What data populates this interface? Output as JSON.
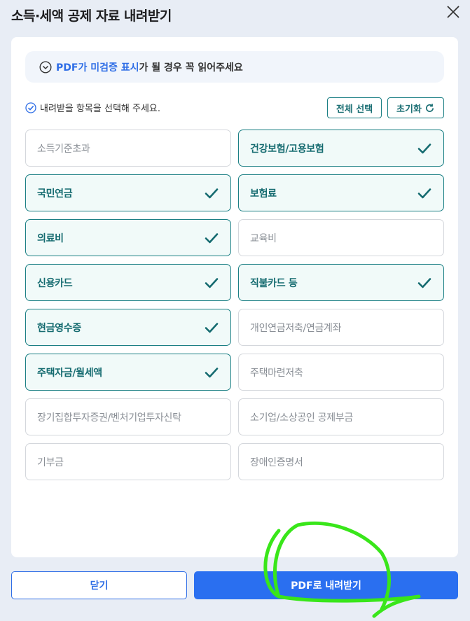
{
  "dialog": {
    "title": "소득·세액 공제 자료 내려받기"
  },
  "notice": {
    "highlight": "PDF가 미검증 표시",
    "rest": "가 될 경우 꼭 읽어주세요"
  },
  "instruction": "내려받을 항목을 선택해 주세요.",
  "buttons": {
    "select_all": "전체 선택",
    "reset": "초기화",
    "close": "닫기",
    "download_pdf": "PDF로 내려받기"
  },
  "items": [
    {
      "label": "소득기준초과",
      "selected": false
    },
    {
      "label": "건강보험/고용보험",
      "selected": true
    },
    {
      "label": "국민연금",
      "selected": true
    },
    {
      "label": "보험료",
      "selected": true
    },
    {
      "label": "의료비",
      "selected": true
    },
    {
      "label": "교육비",
      "selected": false
    },
    {
      "label": "신용카드",
      "selected": true
    },
    {
      "label": "직불카드 등",
      "selected": true
    },
    {
      "label": "현금영수증",
      "selected": true
    },
    {
      "label": "개인연금저축/연금계좌",
      "selected": false
    },
    {
      "label": "주택자금/월세액",
      "selected": true
    },
    {
      "label": "주택마련저축",
      "selected": false
    },
    {
      "label": "장기집합투자증권/벤처기업투자신탁",
      "selected": false
    },
    {
      "label": "소기업/소상공인 공제부금",
      "selected": false
    },
    {
      "label": "기부금",
      "selected": false
    },
    {
      "label": "장애인증명서",
      "selected": false
    }
  ],
  "colors": {
    "accent_teal": "#1b7f84",
    "primary_blue": "#2a6ff0",
    "annotation_green": "#39e61a"
  }
}
